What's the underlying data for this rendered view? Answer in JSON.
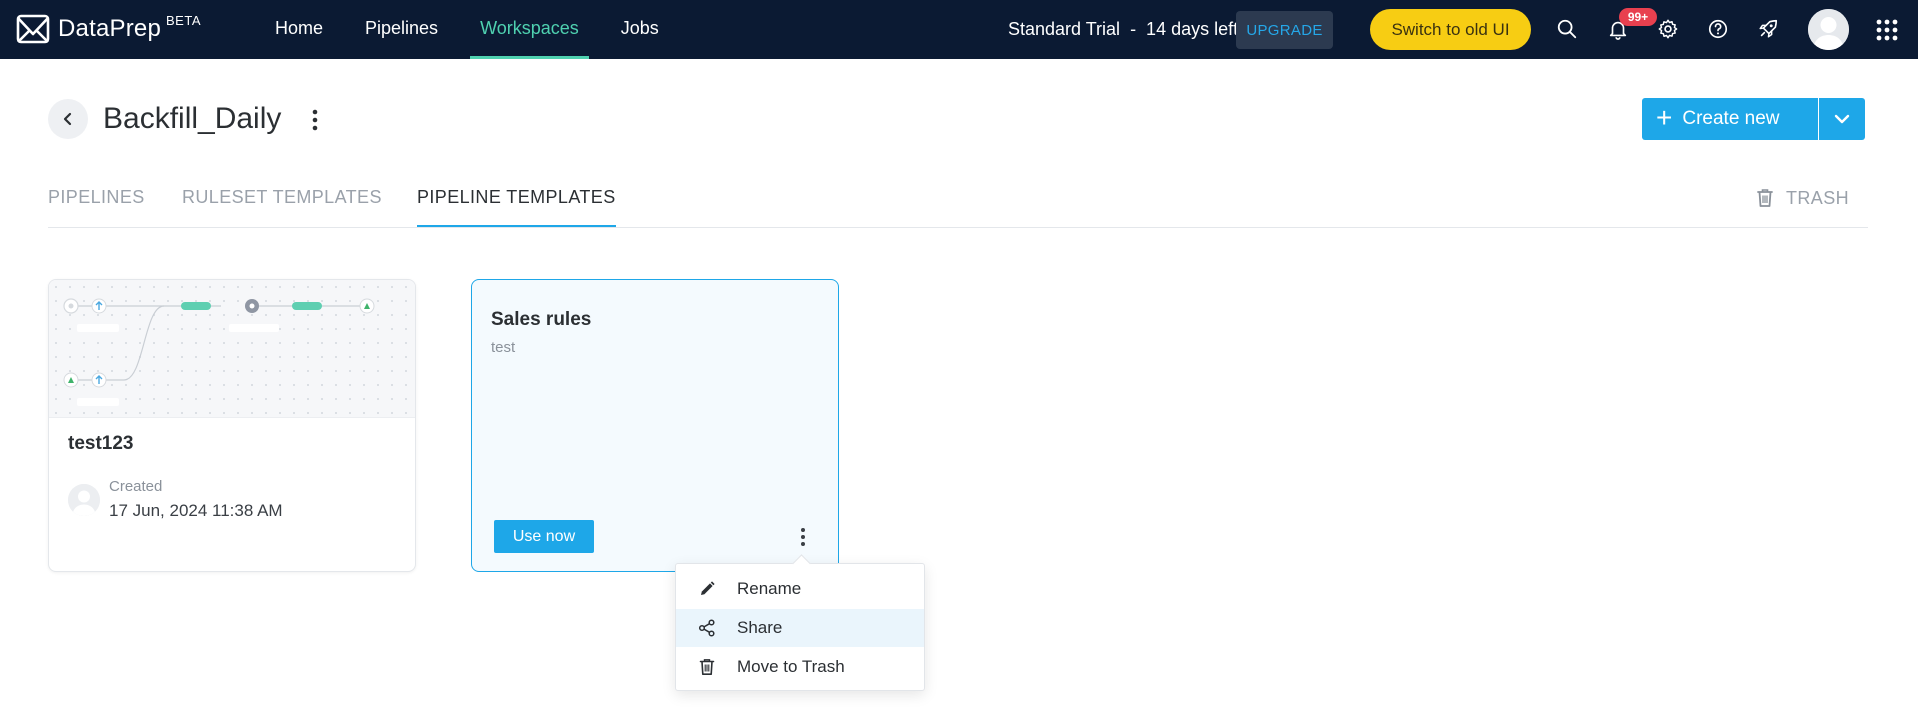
{
  "brand": {
    "name": "DataPrep",
    "badge": "BETA"
  },
  "nav": {
    "items": [
      {
        "label": "Home",
        "active": false
      },
      {
        "label": "Pipelines",
        "active": false
      },
      {
        "label": "Workspaces",
        "active": true
      },
      {
        "label": "Jobs",
        "active": false
      }
    ]
  },
  "topbar": {
    "trial_text": "Standard Trial  -  14 days left",
    "upgrade_label": "UPGRADE",
    "switch_old_ui_label": "Switch to old UI",
    "notification_count": "99+",
    "icons": [
      "search-icon",
      "bell-icon",
      "gear-icon",
      "help-icon",
      "rocket-icon",
      "avatar",
      "apps-grid-icon"
    ]
  },
  "header": {
    "title": "Backfill_Daily",
    "create_label": "Create new"
  },
  "tabs": {
    "items": [
      {
        "label": "PIPELINES",
        "active": false
      },
      {
        "label": "RULESET TEMPLATES",
        "active": false
      },
      {
        "label": "PIPELINE TEMPLATES",
        "active": true
      }
    ],
    "trash_label": "TRASH"
  },
  "cards": [
    {
      "name": "test123",
      "created_label": "Created",
      "created_date": "17 Jun, 2024 11:38 AM"
    },
    {
      "name": "Sales rules",
      "description": "test",
      "use_label": "Use now"
    }
  ],
  "context_menu": {
    "items": [
      {
        "label": "Rename",
        "icon": "pencil-icon"
      },
      {
        "label": "Share",
        "icon": "share-icon",
        "highlighted": true
      },
      {
        "label": "Move to Trash",
        "icon": "trash-icon"
      }
    ]
  },
  "colors": {
    "topbar_bg": "#0b1a33",
    "nav_active": "#4fd1b0",
    "primary": "#1ea7e8",
    "old_ui_button": "#f7cd13",
    "badge": "#e8404f"
  }
}
